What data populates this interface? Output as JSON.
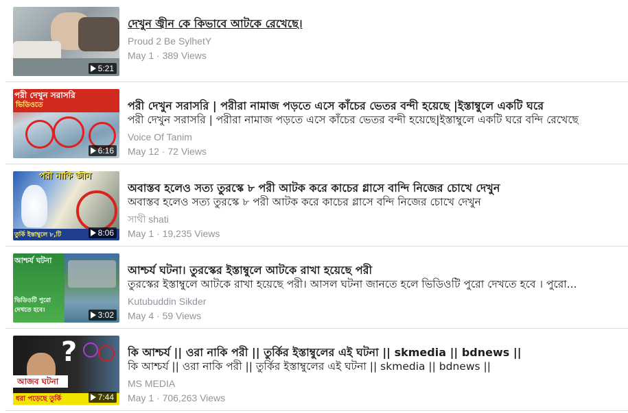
{
  "videos": [
    {
      "title": "দেখুন জ্বীন কে কিভাবে আটকে রেখেছে।",
      "description": "",
      "channel": "Proud 2 Be SylhetY",
      "date": "May 1",
      "views": "389 Views",
      "duration": "5:21"
    },
    {
      "title": "পরী দেখুন সরাসরি | পরীরা নামাজ পড়তে এসে কাঁচের ভেতর বন্দী হয়েছে |ইস্তাম্বুলে একটি ঘরে",
      "description": "পরী দেখুন সরাসরি | পরীরা নামাজ পড়তে এসে কাঁচের ভেতর বন্দী হয়েছে|ইস্তাম্বুলে একটি ঘরে বন্দি রেখেছে",
      "channel": "Voice Of Tanim",
      "date": "May 12",
      "views": "72 Views",
      "duration": "6:16",
      "thumb_text": "পরী দেখুন সরাসরি",
      "thumb_subtext": "ভিডিওতে"
    },
    {
      "title": "অবাস্তব হলেও সত্য তুরস্কে ৮ পরী আটক করে কাচের গ্লাসে বান্দি নিজের চোখে দেখুন",
      "description": "অবাস্তব হলেও সত্য তুরস্কে ৮ পরী আটক করে কাচের গ্লাসে বন্দি নিজের চোখে দেখুন",
      "channel": "সাথী shati",
      "date": "May 1",
      "views": "19,235 Views",
      "duration": "8:06",
      "thumb_text": "পরী নাকি জীন",
      "thumb_subtext": "তুর্কি ইস্তাম্বুলে ৮,টি"
    },
    {
      "title": "আশ্চর্য ঘটনা। তুরস্কের ইস্তাম্বুলে আটকে রাখা হয়েছে পরী",
      "description": "তুরস্কের ইস্তাম্বুলে আটকে রাখা হয়েছে পরী। আসল ঘটনা জানতে হলে ভিডিওটি পুরো দেখতে হবে । পুরো...",
      "channel": "Kutubuddin Sikder",
      "date": "May 4",
      "views": "59 Views",
      "duration": "3:02",
      "thumb_text": "আশ্চর্য ঘটনা",
      "thumb_subtext": "ভিডিওটি পুরো দেখতে হবে।"
    },
    {
      "title": "কি আশ্চর্য || ওরা নাকি পরী || তুর্কির ইস্তাম্বুলের এই ঘটনা || skmedia || bdnews ||",
      "description": "কি আশ্চর্য || ওরা নাকি পরী || তুর্কির ইস্তাম্বুলের এই ঘটনা || skmedia || bdnews ||",
      "channel": "MS MEDIA",
      "date": "May 1",
      "views": "706,263 Views",
      "duration": "7:44",
      "thumb_text": "আজব ঘটনা",
      "thumb_subtext": "ধরা পড়েছে তুর্কি"
    }
  ],
  "separator": " · ",
  "icons": {
    "duration": "play-icon",
    "thumb_mark": "question-mark-icon"
  },
  "colors": {
    "title": "#1c1e21",
    "secondary": "#90949c",
    "divider": "#dadde1",
    "badge_bg": "#000000"
  }
}
